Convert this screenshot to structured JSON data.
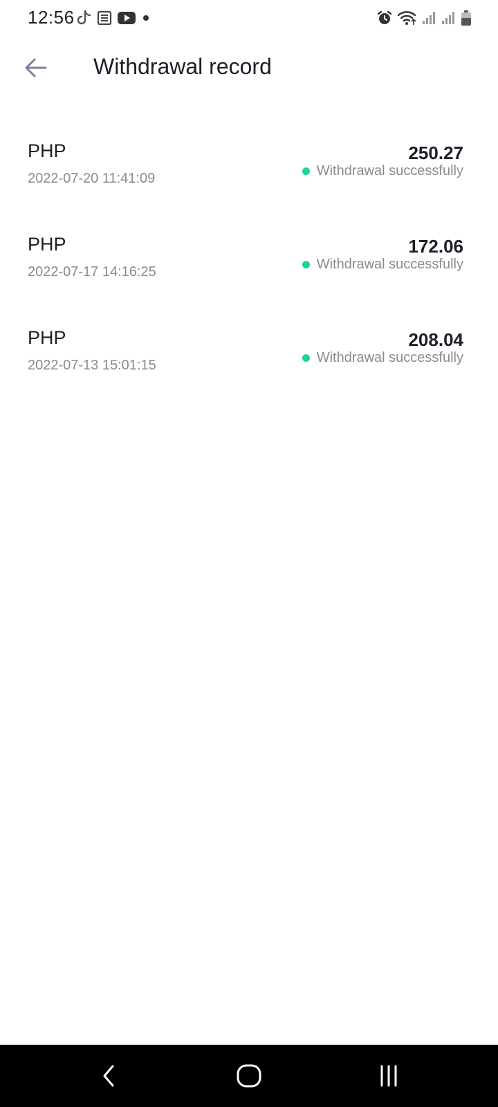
{
  "status_bar": {
    "time": "12:56",
    "left_icons": [
      "tiktok-icon",
      "news-icon",
      "youtube-icon",
      "dot-icon"
    ],
    "right_icons": [
      "alarm-icon",
      "wifi-icon",
      "signal-icon",
      "signal-icon",
      "battery-icon"
    ]
  },
  "header": {
    "back_icon": "arrow-left-icon",
    "title": "Withdrawal record"
  },
  "records": [
    {
      "currency": "PHP",
      "datetime": "2022-07-20 11:41:09",
      "amount": "250.27",
      "status": "Withdrawal successfully"
    },
    {
      "currency": "PHP",
      "datetime": "2022-07-17 14:16:25",
      "amount": "172.06",
      "status": "Withdrawal successfully"
    },
    {
      "currency": "PHP",
      "datetime": "2022-07-13 15:01:15",
      "amount": "208.04",
      "status": "Withdrawal successfully"
    }
  ],
  "colors": {
    "status_success": "#1dd39a",
    "back_arrow": "#7b7f9e",
    "title_text": "#1e1e28",
    "secondary_text": "#8a8a90",
    "nav_bar_bg": "#000000"
  },
  "nav_bar": {
    "buttons": [
      "back-nav-icon",
      "home-nav-icon",
      "recents-nav-icon"
    ]
  }
}
